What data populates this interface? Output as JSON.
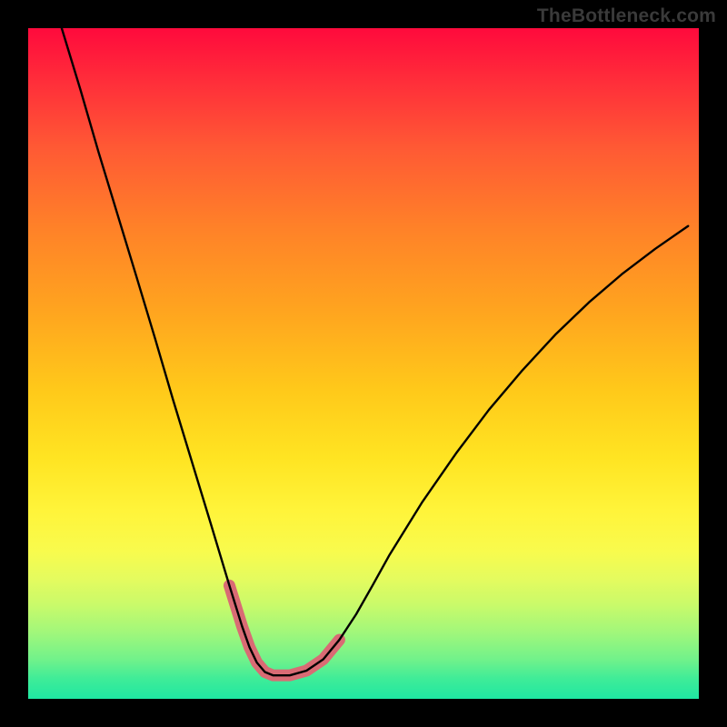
{
  "watermark": {
    "text": "TheBottleneck.com"
  },
  "chart_data": {
    "type": "line",
    "title": "",
    "xlabel": "",
    "ylabel": "",
    "xlim": [
      0,
      100
    ],
    "ylim": [
      0,
      100
    ],
    "grid": false,
    "legend": false,
    "series": [
      {
        "name": "bottleneck-curve",
        "x": [
          5.0,
          7.8,
          10.5,
          13.3,
          16.1,
          18.9,
          21.6,
          24.4,
          27.2,
          30.0,
          31.9,
          33.0,
          34.1,
          35.3,
          36.5,
          39.0,
          41.5,
          44.0,
          46.4,
          48.9,
          51.4,
          53.9,
          58.8,
          63.8,
          68.7,
          73.7,
          78.6,
          83.6,
          88.5,
          93.5,
          98.4
        ],
        "y": [
          100.0,
          90.8,
          81.5,
          72.3,
          63.1,
          53.8,
          44.6,
          35.4,
          26.2,
          16.9,
          10.8,
          7.7,
          5.4,
          4.0,
          3.5,
          3.5,
          4.2,
          5.9,
          8.8,
          12.6,
          17.0,
          21.5,
          29.4,
          36.6,
          43.1,
          49.0,
          54.3,
          59.1,
          63.3,
          67.1,
          70.5
        ],
        "color": "#000000",
        "stroke_width": 2.4
      },
      {
        "name": "bottleneck-valley-highlight",
        "x": [
          30.0,
          31.9,
          33.0,
          34.1,
          35.3,
          36.5,
          39.0,
          41.5,
          44.0,
          46.4
        ],
        "y": [
          16.9,
          10.8,
          7.7,
          5.4,
          4.0,
          3.5,
          3.5,
          4.2,
          5.9,
          8.8
        ],
        "color": "#d96b74",
        "stroke_width": 13
      }
    ],
    "background_gradient": {
      "top": "#ff0a3c",
      "bottom": "#1fe7a2"
    }
  }
}
